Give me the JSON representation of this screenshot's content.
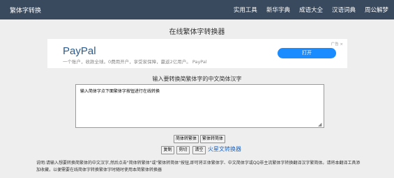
{
  "header": {
    "brand": "繁体字转换",
    "nav": [
      "实用工具",
      "新华字典",
      "成语大全",
      "汉语词典",
      "周公解梦"
    ]
  },
  "page_title": "在线繁体字转换器",
  "ad": {
    "brand": "PayPal",
    "desc": "一个账户，收款全球。0费用开户，享受家保障，赢返2亿用户。 PayPal",
    "tag": "广告 ×",
    "button": "打开"
  },
  "prompt": "输入要转换简繁体字的中文简体汉字",
  "input": {
    "value": "输入简体字点下面繁体字按钮进行在线转换"
  },
  "buttons": {
    "simplified_to_traditional": "简体转繁体",
    "traditional_to_simplified": "繁体转简体",
    "copy": "复制",
    "cut": "剪切",
    "clear": "清空",
    "mars": "火星文转换器"
  },
  "help_text": "说明:请输入想要转换简繁体的中文汉字,然后点击\"简体转繁体\"或\"繁体转简体\"按钮,即可将正体繁体字、中文简体字或QQ非主流繁体字转换翻译汉字繁简体。请将本翻译工具添加收藏，以便需要在线简体字转换繁体字时随时使用本简繁体转换器"
}
